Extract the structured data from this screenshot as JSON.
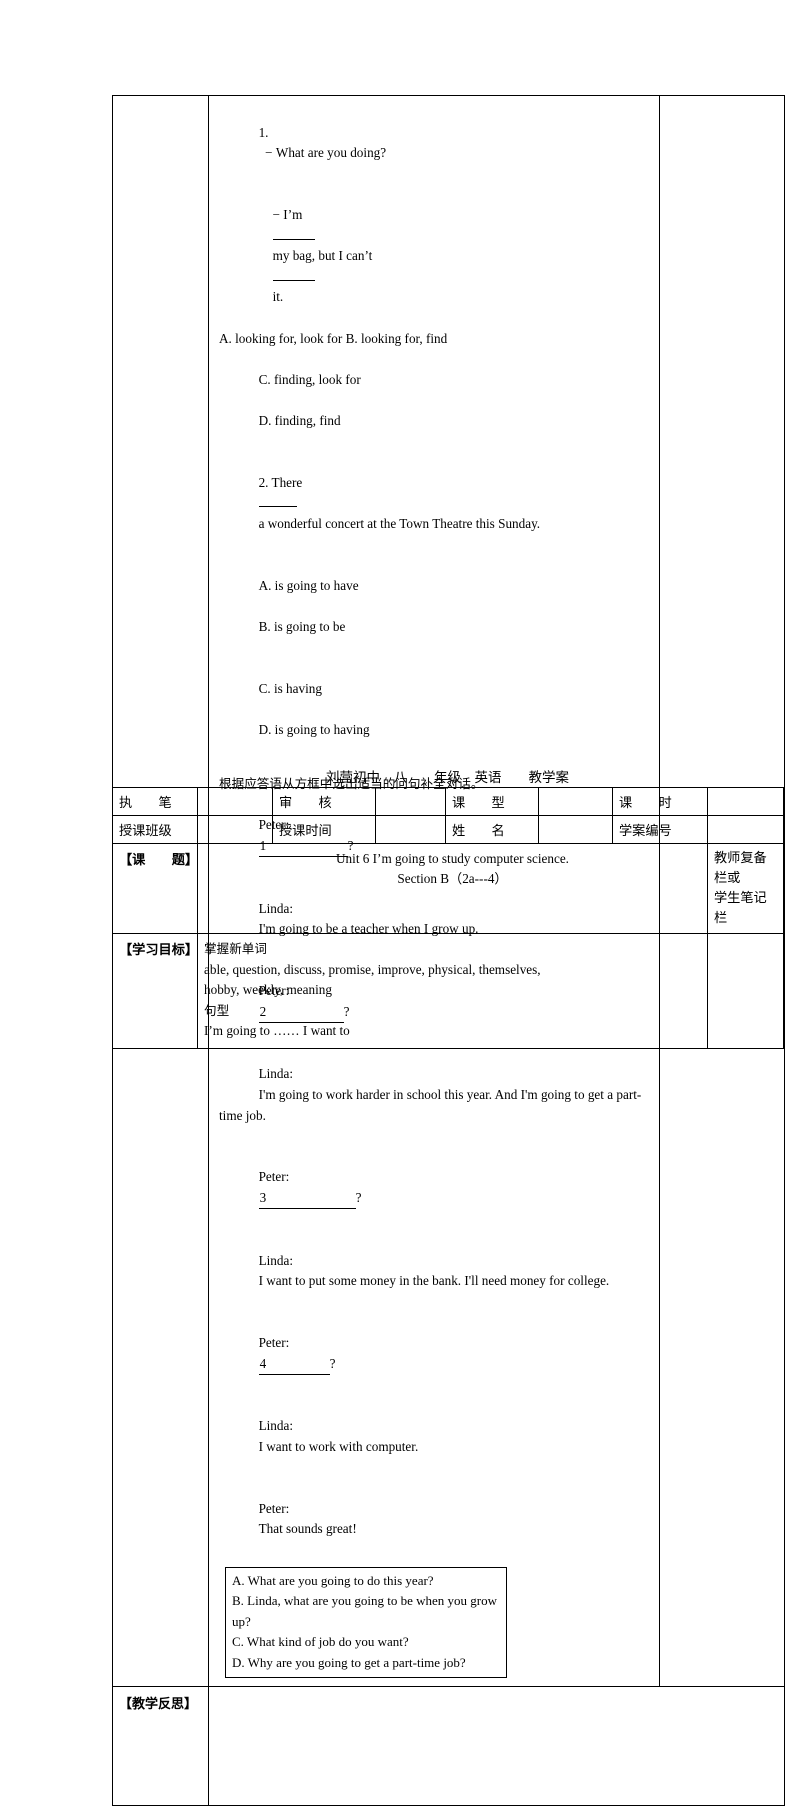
{
  "exercises": {
    "q1": {
      "number": "1.",
      "dash": "−",
      "prompt": "What are you doing?",
      "answer_pre": "I’m",
      "answer_mid": "my bag, but I can’t",
      "answer_post": "it.",
      "choices_line1": "A. looking for, look for B. looking for, find",
      "choices_line2_a": "C. finding, look for",
      "choices_line2_b": "D. finding, find"
    },
    "q2": {
      "stem_pre": "2. There",
      "stem_post": "a wonderful concert at the Town Theatre this Sunday.",
      "choices_line1_a": "A. is going to have",
      "choices_line1_b": "B. is going to be",
      "choices_line2_a": "C. is having",
      "choices_line2_b": "D. is going to having"
    }
  },
  "dialogue": {
    "instruction": "根据应答语从方框中选出适当的问句补全对话。",
    "lines": [
      {
        "speaker": "Peter:",
        "blank": "1",
        "suffix": "?"
      },
      {
        "speaker": "Linda:",
        "text": "I'm going to be a teacher when I grow up."
      },
      {
        "speaker": "Peter:",
        "blank": "2",
        "suffix": "?"
      },
      {
        "speaker": "Linda:",
        "text": "I'm going to work harder in school this year. And I'm going to get a part-time job."
      },
      {
        "speaker": "Peter:",
        "blank": "3",
        "suffix": "?"
      },
      {
        "speaker": "Linda:",
        "text": "I want to put some money in the bank. I'll need money for college."
      },
      {
        "speaker": "Peter:",
        "blank": "4",
        "suffix": "?"
      },
      {
        "speaker": "Linda:",
        "text": "I want to work with computer."
      },
      {
        "speaker": "Peter:",
        "text": "That sounds great!"
      }
    ],
    "options": [
      "A. What are you going to do this year?",
      "B. Linda, what are you going to be when you grow up?",
      "C. What kind of job do you want?",
      "D. Why are you going to get a part-time job?"
    ]
  },
  "reflection": {
    "label": "【教学反思】",
    "content": ""
  },
  "plan": {
    "heading": "刘营初中　八　　年级　英语　　教学案",
    "row1": {
      "label1": "执　　笔",
      "value1": "",
      "label2": "审　　核",
      "value2": "",
      "label3": "课　　型",
      "value3": "",
      "label4": "课　　时",
      "value4": ""
    },
    "row2": {
      "label1": "授课班级",
      "value1": "",
      "label2": "授课时间",
      "value2": "",
      "label3": "姓　　名",
      "value3": "",
      "label4": "学案编号",
      "value4": ""
    },
    "topic": {
      "label": "【课　　题】",
      "line1": "Unit 6 I’m going to study computer science.",
      "line2": "Section B（2a---4）",
      "notes_line1": "教师复备栏或",
      "notes_line2": "学生笔记栏"
    },
    "goals": {
      "label": "【学习目标】",
      "line1": "掌握新单词",
      "line2": "able, question, discuss, promise, improve, physical, themselves,",
      "line3": "hobby, weekly, meaning",
      "line4": "句型",
      "line5": "I’m going to …… I want to",
      "notes": ""
    }
  }
}
